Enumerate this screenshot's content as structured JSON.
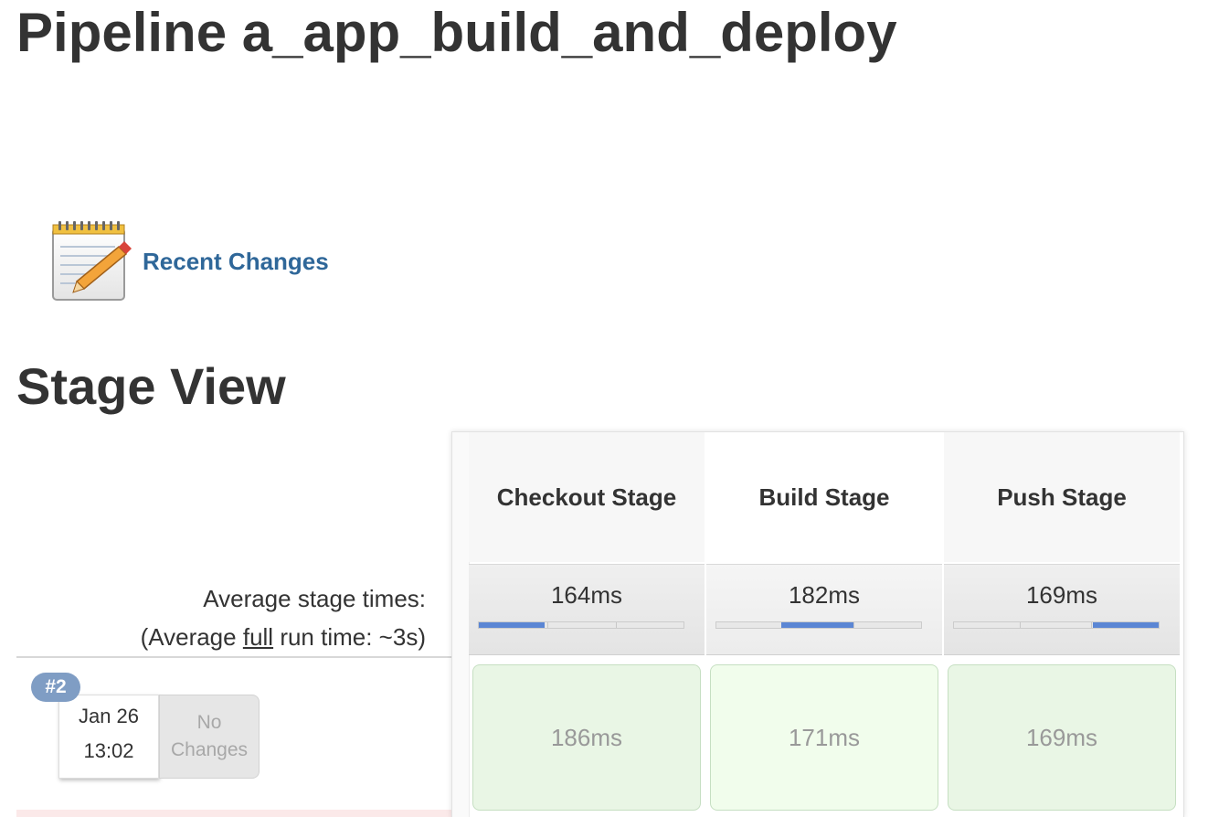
{
  "page": {
    "title": "Pipeline a_app_build_and_deploy"
  },
  "recent_changes": {
    "label": "Recent Changes",
    "icon": "notepad-pencil-icon"
  },
  "stage_view": {
    "title": "Stage View",
    "avg_label_line1": "Average stage times:",
    "avg_label_prefix": "(Average ",
    "avg_label_link": "full",
    "avg_label_suffix": " run time: ~3s)",
    "stages": [
      {
        "name": "Checkout Stage",
        "avg_time": "164ms",
        "bar_segment": 1
      },
      {
        "name": "Build Stage",
        "avg_time": "182ms",
        "bar_segment": 2
      },
      {
        "name": "Push Stage",
        "avg_time": "169ms",
        "bar_segment": 3
      }
    ],
    "builds": [
      {
        "number": "#2",
        "date": "Jan 26",
        "time": "13:02",
        "changes_line1": "No",
        "changes_line2": "Changes",
        "stage_times": [
          "186ms",
          "171ms",
          "169ms"
        ]
      }
    ]
  },
  "colors": {
    "link": "#2f6799",
    "badge": "#7f9dc4",
    "success_cell": "#e9f6e5",
    "progress_fill": "#5b86d4"
  }
}
